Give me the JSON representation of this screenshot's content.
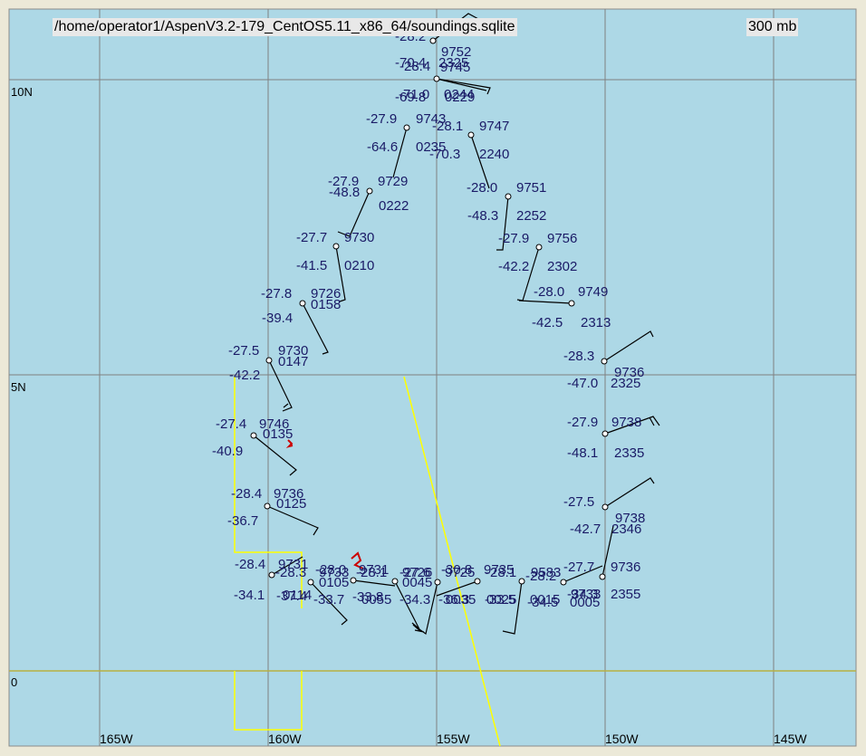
{
  "header": {
    "file_path": "/home/operator1/AspenV3.2-179_CentOS5.11_x86_64/soundings.sqlite",
    "level": "300 mb"
  },
  "axes": {
    "lat_labels": [
      "10N",
      "5N",
      "0"
    ],
    "lon_labels": [
      "165W",
      "160W",
      "155W",
      "150W",
      "145W"
    ]
  },
  "colors": {
    "ocean": "#add8e6",
    "grid": "#808080",
    "equator": "#b8b040",
    "boundary": "#ffff00",
    "station_text": "#1a1a66",
    "barb": "#000000",
    "precip_marker": "#cc0000"
  },
  "stations": [
    {
      "temp": "-28.2",
      "pres": "9752",
      "dew": "-70.4",
      "time": "2325"
    },
    {
      "temp": "-28.4",
      "pres": "9745",
      "dew": "-70.4",
      "time": "2325"
    },
    {
      "temp": "-71.0",
      "pres": "0244",
      "dew": "-69.8",
      "time": "0229"
    },
    {
      "temp": "-27.9",
      "pres": "9743",
      "dew": "-64.6",
      "time": "0235"
    },
    {
      "temp": "-28.1",
      "pres": "9747",
      "dew": "-70.3",
      "time": "2240"
    },
    {
      "temp": "-27.9",
      "pres": "9729",
      "dew": "-48.8",
      "time": "0222"
    },
    {
      "temp": "-28.0",
      "pres": "9751",
      "dew": "-48.3",
      "time": "2252"
    },
    {
      "temp": "-27.7",
      "pres": "9730",
      "dew": "-41.5",
      "time": "0210"
    },
    {
      "temp": "-27.9",
      "pres": "9756",
      "dew": "-42.2",
      "time": "2302"
    },
    {
      "temp": "-27.8",
      "pres": "9726",
      "dew": "-39.4",
      "time": "0158"
    },
    {
      "temp": "-28.0",
      "pres": "9749",
      "dew": "-42.5",
      "time": "2313"
    },
    {
      "temp": "-27.5",
      "pres": "9730",
      "dew": "-42.2",
      "time": "0147"
    },
    {
      "temp": "-28.3",
      "pres": "9736",
      "dew": "-47.0",
      "time": "2325"
    },
    {
      "temp": "-27.4",
      "pres": "9746",
      "dew": "-40.9",
      "time": "0135"
    },
    {
      "temp": "-27.9",
      "pres": "9738",
      "dew": "-48.1",
      "time": "2335"
    },
    {
      "temp": "-28.4",
      "pres": "9736",
      "dew": "-36.7",
      "time": "0125"
    },
    {
      "temp": "-27.5",
      "pres": "9738",
      "dew": "-42.7",
      "time": "2346"
    },
    {
      "temp": "-28.4",
      "pres": "9731",
      "dew": "-34.1",
      "time": "0114"
    },
    {
      "temp": "-28.3",
      "pres": "9733",
      "dew": "-37.4",
      "time": "0105"
    },
    {
      "temp": "-28.0",
      "pres": "9731",
      "dew": "-33.7",
      "time": "0055"
    },
    {
      "temp": "-28.1",
      "pres": "9726",
      "dew": "-33.8",
      "time": "0045"
    },
    {
      "temp": "-27.6",
      "pres": "9725",
      "dew": "-34.3",
      "time": "0035"
    },
    {
      "temp": "-30.8",
      "pres": "9735",
      "dew": "-36.3",
      "time": "0025"
    },
    {
      "temp": "-28.1",
      "pres": "9583",
      "dew": "-33.5",
      "time": "0015"
    },
    {
      "temp": "-28.2",
      "pres": "9733",
      "dew": "-34.5",
      "time": "0005"
    },
    {
      "temp": "-27.7",
      "pres": "9736",
      "dew": "-34.3",
      "time": "2355"
    }
  ]
}
